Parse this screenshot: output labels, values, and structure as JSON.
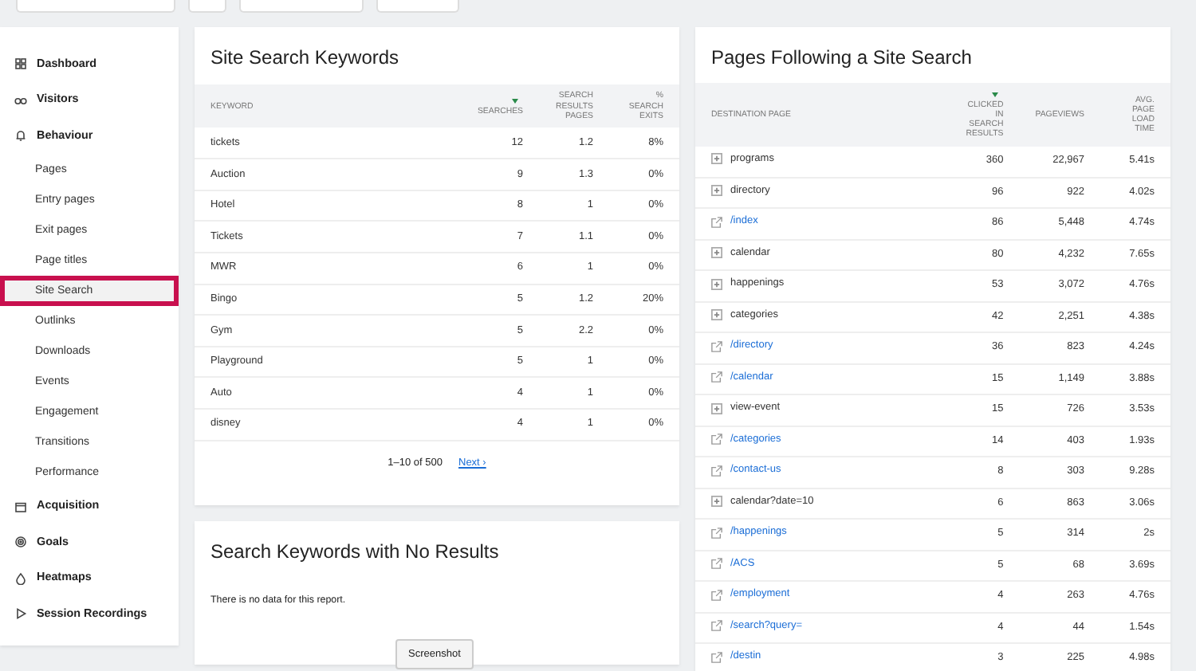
{
  "toolbar": {
    "buttons": [
      {
        "kind": "search"
      },
      {
        "kind": "small"
      },
      {
        "kind": "wide"
      },
      {
        "kind": "medium"
      }
    ]
  },
  "sidebar": {
    "items": [
      {
        "label": "Dashboard",
        "selected": false
      },
      {
        "label": "Visitors",
        "selected": false
      },
      {
        "label": "Behaviour",
        "selected": false,
        "children": [
          {
            "label": "Pages",
            "selected": false
          },
          {
            "label": "Entry pages",
            "selected": false
          },
          {
            "label": "Exit pages",
            "selected": false
          },
          {
            "label": "Page titles",
            "selected": false
          },
          {
            "label": "Site Search",
            "selected": true
          },
          {
            "label": "Outlinks",
            "selected": false
          },
          {
            "label": "Downloads",
            "selected": false
          },
          {
            "label": "Events",
            "selected": false
          },
          {
            "label": "Engagement",
            "selected": false
          },
          {
            "label": "Transitions",
            "selected": false
          },
          {
            "label": "Performance",
            "selected": false
          }
        ]
      },
      {
        "label": "Acquisition",
        "selected": false
      },
      {
        "label": "Goals",
        "selected": false
      },
      {
        "label": "Heatmaps",
        "selected": false
      },
      {
        "label": "Session Recordings",
        "selected": false
      }
    ]
  },
  "keywords_report": {
    "title": "Site Search Keywords",
    "columns": [
      {
        "label": "KEYWORD",
        "sorted": false
      },
      {
        "label": "SEARCHES",
        "sorted": true
      },
      {
        "label": "SEARCH RESULTS PAGES",
        "sorted": false
      },
      {
        "label": "% SEARCH EXITS",
        "sorted": false
      }
    ],
    "rows": [
      [
        "tickets",
        "12",
        "1.2",
        "8%"
      ],
      [
        "Auction",
        "9",
        "1.3",
        "0%"
      ],
      [
        "Hotel",
        "8",
        "1",
        "0%"
      ],
      [
        "Tickets",
        "7",
        "1.1",
        "0%"
      ],
      [
        "MWR",
        "6",
        "1",
        "0%"
      ],
      [
        "Bingo",
        "5",
        "1.2",
        "20%"
      ],
      [
        "Gym",
        "5",
        "2.2",
        "0%"
      ],
      [
        "Playground",
        "5",
        "1",
        "0%"
      ],
      [
        "Auto",
        "4",
        "1",
        "0%"
      ],
      [
        "disney",
        "4",
        "1",
        "0%"
      ]
    ],
    "pagination": "1–10 of 500",
    "next_link": "Next ›"
  },
  "no_results_report": {
    "title": "Search Keywords with No Results",
    "message": "There is no data for this report.",
    "button": "Screenshot"
  },
  "pages_report": {
    "title": "Pages Following a Site Search",
    "columns": [
      {
        "label": "DESTINATION PAGE",
        "sorted": false
      },
      {
        "label": "CLICKED IN SEARCH RESULTS",
        "sorted": true
      },
      {
        "label": "PAGEVIEWS",
        "sorted": false
      },
      {
        "label": "AVG. PAGE LOAD TIME",
        "sorted": false
      }
    ],
    "rows": [
      {
        "kind": "group",
        "cells": [
          "programs",
          "360",
          "22,967",
          "5.41s"
        ]
      },
      {
        "kind": "group",
        "cells": [
          "directory",
          "96",
          "922",
          "4.02s"
        ]
      },
      {
        "kind": "link",
        "cells": [
          "/index",
          "86",
          "5,448",
          "4.74s"
        ]
      },
      {
        "kind": "group",
        "cells": [
          "calendar",
          "80",
          "4,232",
          "7.65s"
        ]
      },
      {
        "kind": "group",
        "cells": [
          "happenings",
          "53",
          "3,072",
          "4.76s"
        ]
      },
      {
        "kind": "group",
        "cells": [
          "categories",
          "42",
          "2,251",
          "4.38s"
        ]
      },
      {
        "kind": "link",
        "cells": [
          "/directory",
          "36",
          "823",
          "4.24s"
        ]
      },
      {
        "kind": "link",
        "cells": [
          "/calendar",
          "15",
          "1,149",
          "3.88s"
        ]
      },
      {
        "kind": "group",
        "cells": [
          "view-event",
          "15",
          "726",
          "3.53s"
        ]
      },
      {
        "kind": "link",
        "cells": [
          "/categories",
          "14",
          "403",
          "1.93s"
        ]
      },
      {
        "kind": "link",
        "cells": [
          "/contact-us",
          "8",
          "303",
          "9.28s"
        ]
      },
      {
        "kind": "group",
        "cells": [
          "calendar?date=10",
          "6",
          "863",
          "3.06s"
        ]
      },
      {
        "kind": "link",
        "cells": [
          "/happenings",
          "5",
          "314",
          "2s"
        ]
      },
      {
        "kind": "link",
        "cells": [
          "/ACS",
          "5",
          "68",
          "3.69s"
        ]
      },
      {
        "kind": "link",
        "cells": [
          "/employment",
          "4",
          "263",
          "4.76s"
        ]
      },
      {
        "kind": "link",
        "cells": [
          "/search?query=",
          "4",
          "44",
          "1.54s"
        ]
      },
      {
        "kind": "link",
        "cells": [
          "/destin",
          "3",
          "225",
          "4.98s"
        ]
      }
    ]
  }
}
